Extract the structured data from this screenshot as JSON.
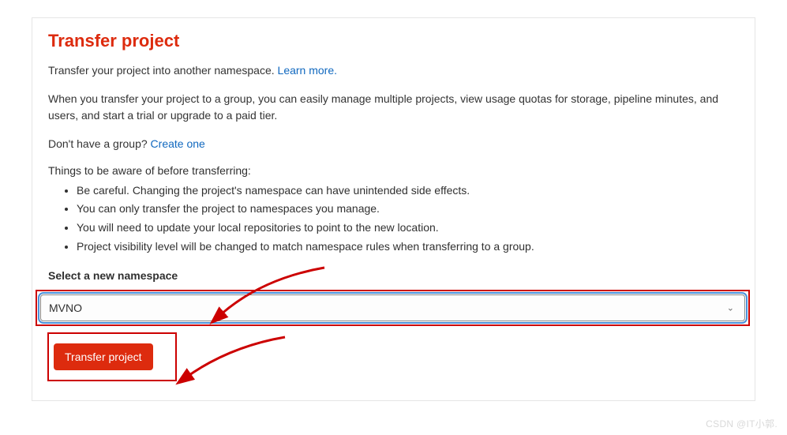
{
  "title": "Transfer project",
  "intro_prefix": "Transfer your project into another namespace. ",
  "learn_more": "Learn more.",
  "group_desc": "When you transfer your project to a group, you can easily manage multiple projects, view usage quotas for storage, pipeline minutes, and users, and start a trial or upgrade to a paid tier.",
  "no_group_prefix": "Don't have a group? ",
  "create_one": "Create one",
  "aware_heading": "Things to be aware of before transferring:",
  "bullets": [
    "Be careful. Changing the project's namespace can have unintended side effects.",
    "You can only transfer the project to namespaces you manage.",
    "You will need to update your local repositories to point to the new location.",
    "Project visibility level will be changed to match namespace rules when transferring to a group."
  ],
  "select_label": "Select a new namespace",
  "namespace_value": "MVNO",
  "button_label": "Transfer project",
  "watermark": "CSDN @IT小郭."
}
